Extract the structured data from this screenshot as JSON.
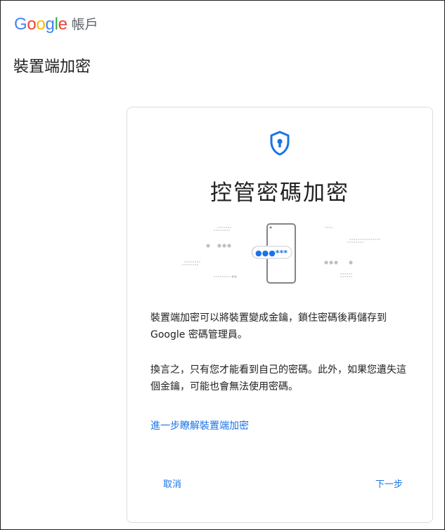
{
  "header": {
    "logo_letters": [
      "G",
      "o",
      "o",
      "g",
      "l",
      "e"
    ],
    "product_name": "帳戶"
  },
  "page": {
    "title": "裝置端加密"
  },
  "dialog": {
    "title": "控管密碼加密",
    "paragraph1": "裝置端加密可以將裝置變成金鑰，鎖住密碼後再儲存到 Google 密碼管理員。",
    "paragraph2": "換言之，只有您才能看到自己的密碼。此外，如果您遺失這個金鑰，可能也會無法使用密碼。",
    "learn_more": "進一步瞭解裝置端加密",
    "cancel_label": "取消",
    "next_label": "下一步",
    "password_mask": "●●●***"
  },
  "colors": {
    "accent": "#1a73e8",
    "google_blue": "#4285F4",
    "google_red": "#EA4335",
    "google_yellow": "#FBBC05",
    "google_green": "#34A853"
  }
}
